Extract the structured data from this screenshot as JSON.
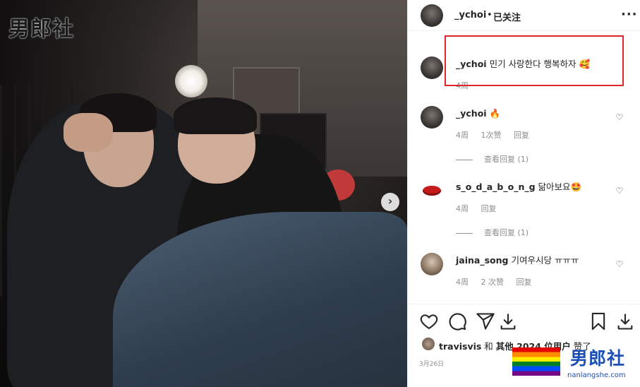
{
  "photo": {
    "watermark": "男郎社",
    "next_icon": "chevron-right-icon"
  },
  "header": {
    "username": "_ychoi",
    "separator": "•",
    "follow_label": "已关注",
    "more_icon": "more-horizontal-icon"
  },
  "caption": {
    "username": "_ychoi",
    "text": "민기 사랑한다 행복하자 🥰",
    "time": "4周"
  },
  "comments": [
    {
      "username": "_ychoi",
      "text": "🔥",
      "time": "4周",
      "likes": "1次赞",
      "reply": "回复",
      "view_replies": "查看回复 (1)"
    },
    {
      "username": "s_o_d_a_b_o_n_g",
      "text": "닮아보요🤩",
      "time": "4周",
      "reply": "回复",
      "view_replies": "查看回复 (1)"
    },
    {
      "username": "jaina_song",
      "text": "기여우시당 ㅠㅠㅠ",
      "time": "4周",
      "likes": "2 次赞",
      "reply": "回复"
    }
  ],
  "likes_line": {
    "user": "travisvis",
    "and": " 和 ",
    "others": "其他 2024 位用户",
    "suffix": " 赞了"
  },
  "date": "3月26日",
  "brand": {
    "name": "男郎社",
    "url": "nanlangshe.com"
  },
  "colors": {
    "highlight": "#e0282c",
    "muted": "#8e8e8e",
    "text": "#262626"
  }
}
